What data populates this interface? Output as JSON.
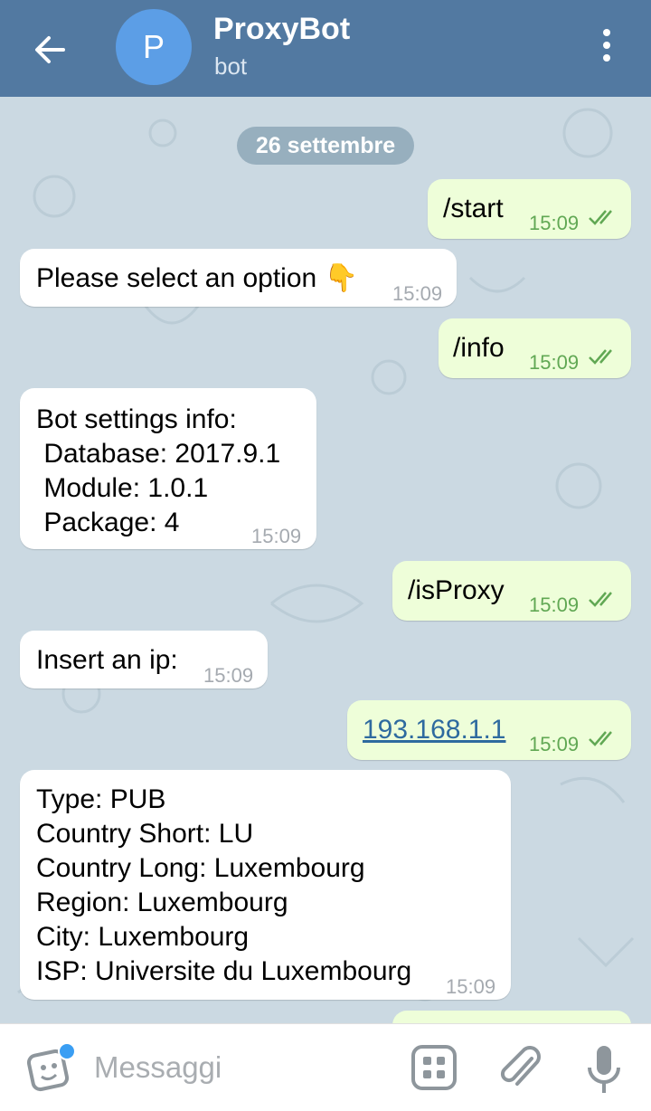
{
  "header": {
    "title": "ProxyBot",
    "subtitle": "bot",
    "avatar_letter": "P",
    "icons": {
      "back": "arrow-left-icon",
      "menu": "more-vertical-icon"
    },
    "colors": {
      "bar": "#5279a1",
      "avatar": "#5c9ee6"
    }
  },
  "chat": {
    "date_label": "26 settembre",
    "messages": [
      {
        "dir": "out",
        "text": "/start",
        "time": "15:09",
        "status": "read"
      },
      {
        "dir": "in",
        "text": "Please select an option 👇",
        "time": "15:09"
      },
      {
        "dir": "out",
        "text": "/info",
        "time": "15:09",
        "status": "read"
      },
      {
        "dir": "in",
        "text": "Bot settings info:\n Database: 2017.9.1\n Module: 1.0.1\n Package: 4",
        "time": "15:09"
      },
      {
        "dir": "out",
        "text": "/isProxy",
        "time": "15:09",
        "status": "read"
      },
      {
        "dir": "in",
        "text": "Insert an ip:",
        "time": "15:09"
      },
      {
        "dir": "out",
        "text": "193.168.1.1",
        "time": "15:09",
        "status": "read",
        "is_link": true
      },
      {
        "dir": "in",
        "text": "Type: PUB\nCountry Short: LU\nCountry Long: Luxembourg\nRegion: Luxembourg\nCity: Luxembourg\nISP: Universite du Luxembourg",
        "time": "15:09"
      }
    ],
    "colors": {
      "incoming": "#ffffff",
      "outgoing": "#eefed9",
      "tick": "#61a854"
    }
  },
  "input": {
    "placeholder": "Messaggi",
    "icons": {
      "emoji": "sticker-icon",
      "commands": "bot-commands-icon",
      "attach": "paperclip-icon",
      "mic": "microphone-icon"
    }
  }
}
